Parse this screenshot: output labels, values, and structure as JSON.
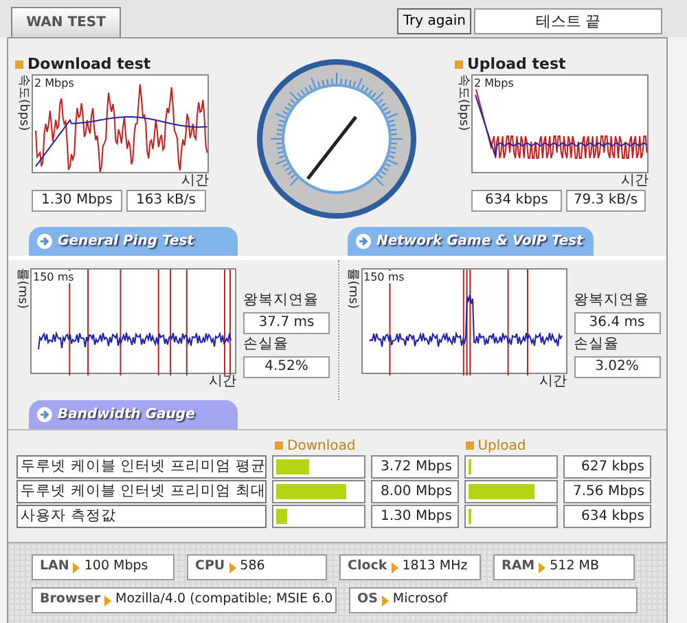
{
  "tabs": [
    {
      "label": "WAN TEST",
      "selected": true
    }
  ],
  "toolbar": {
    "retry_button": "Try again",
    "status": "테스트 끝"
  },
  "download_test": {
    "title": "Download test",
    "y_axis": "속도(bps)",
    "scale": "2 Mbps",
    "x_axis": "시간",
    "readings": [
      "1.30 Mbps",
      "163 kB/s"
    ]
  },
  "upload_test": {
    "title": "Upload test",
    "y_axis": "속도(bps)",
    "scale": "2 Mbps",
    "x_axis": "시간",
    "readings": [
      "634 kbps",
      "79.3 kB/s"
    ]
  },
  "ping_sections": [
    {
      "title": "General Ping Test",
      "y_axis": "률(ms)",
      "scale": "150 ms",
      "x_axis": "시간",
      "latency_label": "왕복지연율",
      "latency": "37.7 ms",
      "loss_label": "손실율",
      "loss": "4.52%"
    },
    {
      "title": "Network Game & VoIP Test",
      "y_axis": "률(ms)",
      "scale": "150 ms",
      "x_axis": "시간",
      "latency_label": "왕복지연율",
      "latency": "36.4 ms",
      "loss_label": "손실율",
      "loss": "3.02%"
    }
  ],
  "bandwidth": {
    "title": "Bandwidth Gauge",
    "download_heading": "Download",
    "upload_heading": "Upload",
    "rows": [
      {
        "name": "두루넷 케이블 인터넷 프리미엄 평균",
        "download": {
          "level": 0.38,
          "reading": "3.72 Mbps"
        },
        "upload": {
          "level": 0.04,
          "reading": "627 kbps"
        }
      },
      {
        "name": "두루넷 케이블 인터넷 프리미엄 최대",
        "download": {
          "level": 0.82,
          "reading": "8.00 Mbps"
        },
        "upload": {
          "level": 0.77,
          "reading": "7.56 Mbps"
        }
      },
      {
        "name": "사용자 측정값",
        "download": {
          "level": 0.13,
          "reading": "1.30 Mbps"
        },
        "upload": {
          "level": 0.04,
          "reading": "634 kbps"
        }
      }
    ]
  },
  "system_info": [
    [
      {
        "label": "LAN",
        "value": "100 Mbps"
      },
      {
        "label": "CPU",
        "value": "586"
      },
      {
        "label": "Clock",
        "value": "1813 MHz"
      },
      {
        "label": "RAM",
        "value": "512 MB"
      }
    ],
    [
      {
        "label": "Browser",
        "value": "Mozilla/4.0 (compatible; MSIE 6.0"
      },
      {
        "label": "OS",
        "value": "Microsof"
      }
    ]
  ]
}
